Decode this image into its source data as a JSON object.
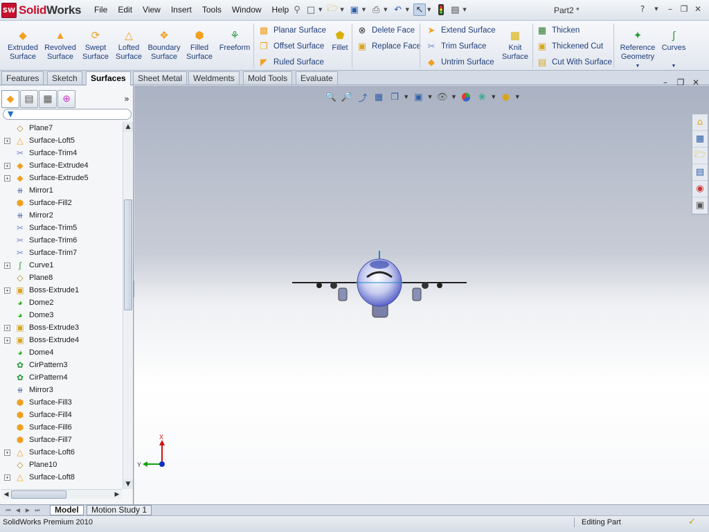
{
  "app": {
    "brand_sw": "SW",
    "brand_solid": "Solid",
    "brand_works": "Works",
    "doc_title": "Part2 *"
  },
  "menu": [
    "File",
    "Edit",
    "View",
    "Insert",
    "Tools",
    "Window",
    "Help"
  ],
  "ribbon": {
    "big_buttons": [
      {
        "label1": "Extruded",
        "label2": "Surface",
        "icon": "extruded-surface-icon"
      },
      {
        "label1": "Revolved",
        "label2": "Surface",
        "icon": "revolved-surface-icon"
      },
      {
        "label1": "Swept",
        "label2": "Surface",
        "icon": "swept-surface-icon"
      },
      {
        "label1": "Lofted",
        "label2": "Surface",
        "icon": "lofted-surface-icon"
      },
      {
        "label1": "Boundary",
        "label2": "Surface",
        "icon": "boundary-surface-icon"
      },
      {
        "label1": "Filled",
        "label2": "Surface",
        "icon": "filled-surface-icon"
      },
      {
        "label1": "Freeform",
        "label2": "",
        "icon": "freeform-icon"
      }
    ],
    "group1": [
      "Planar Surface",
      "Offset Surface",
      "Ruled Surface"
    ],
    "fillet": "Fillet",
    "group2": [
      "Delete Face",
      "Replace Face"
    ],
    "group3": [
      "Extend Surface",
      "Trim Surface",
      "Untrim Surface"
    ],
    "knit1": "Knit",
    "knit2": "Surface",
    "group4": [
      "Thicken",
      "Thickened Cut",
      "Cut With Surface"
    ],
    "ref1": "Reference",
    "ref2": "Geometry",
    "curves": "Curves"
  },
  "tabs": [
    "Features",
    "Sketch",
    "Surfaces",
    "Sheet Metal",
    "Weldments",
    "Mold Tools",
    "Evaluate"
  ],
  "active_tab": "Surfaces",
  "tree": [
    {
      "label": "Plane7",
      "icon": "plane-icon",
      "expandable": false
    },
    {
      "label": "Surface-Loft5",
      "icon": "loft-icon",
      "expandable": true
    },
    {
      "label": "Surface-Trim4",
      "icon": "trim-icon",
      "expandable": false
    },
    {
      "label": "Surface-Extrude4",
      "icon": "surface-extrude-icon",
      "expandable": true
    },
    {
      "label": "Surface-Extrude5",
      "icon": "surface-extrude-icon",
      "expandable": true
    },
    {
      "label": "Mirror1",
      "icon": "mirror-icon",
      "expandable": false
    },
    {
      "label": "Surface-Fill2",
      "icon": "fill-icon",
      "expandable": false
    },
    {
      "label": "Mirror2",
      "icon": "mirror-icon",
      "expandable": false
    },
    {
      "label": "Surface-Trim5",
      "icon": "trim-icon",
      "expandable": false
    },
    {
      "label": "Surface-Trim6",
      "icon": "trim-icon",
      "expandable": false
    },
    {
      "label": "Surface-Trim7",
      "icon": "trim-icon",
      "expandable": false
    },
    {
      "label": "Curve1",
      "icon": "curve-icon",
      "expandable": true
    },
    {
      "label": "Plane8",
      "icon": "plane-icon",
      "expandable": false
    },
    {
      "label": "Boss-Extrude1",
      "icon": "boss-extrude-icon",
      "expandable": true
    },
    {
      "label": "Dome2",
      "icon": "dome-icon",
      "expandable": false
    },
    {
      "label": "Dome3",
      "icon": "dome-icon",
      "expandable": false
    },
    {
      "label": "Boss-Extrude3",
      "icon": "boss-extrude-icon",
      "expandable": true
    },
    {
      "label": "Boss-Extrude4",
      "icon": "boss-extrude-icon",
      "expandable": true
    },
    {
      "label": "Dome4",
      "icon": "dome-icon",
      "expandable": false
    },
    {
      "label": "CirPattern3",
      "icon": "circular-pattern-icon",
      "expandable": false
    },
    {
      "label": "CirPattern4",
      "icon": "circular-pattern-icon",
      "expandable": false
    },
    {
      "label": "Mirror3",
      "icon": "mirror-icon",
      "expandable": false
    },
    {
      "label": "Surface-Fill3",
      "icon": "fill-icon",
      "expandable": false
    },
    {
      "label": "Surface-Fill4",
      "icon": "fill-icon",
      "expandable": false
    },
    {
      "label": "Surface-Fill6",
      "icon": "fill-icon",
      "expandable": false
    },
    {
      "label": "Surface-Fill7",
      "icon": "fill-icon",
      "expandable": false
    },
    {
      "label": "Surface-Loft6",
      "icon": "loft-icon",
      "expandable": true
    },
    {
      "label": "Plane10",
      "icon": "plane-icon",
      "expandable": false
    },
    {
      "label": "Surface-Loft8",
      "icon": "loft-icon",
      "expandable": true
    }
  ],
  "triad": {
    "x": "X",
    "y": "Y"
  },
  "bottom_tabs": [
    "Model",
    "Motion Study 1"
  ],
  "status": {
    "product": "SolidWorks Premium 2010",
    "mode": "Editing Part"
  },
  "colors": {
    "brand_red": "#c8102e",
    "ribbon_text": "#1f3d7a",
    "icon_orange": "#f0a020",
    "aircraft_blue": "#7b86d8"
  }
}
